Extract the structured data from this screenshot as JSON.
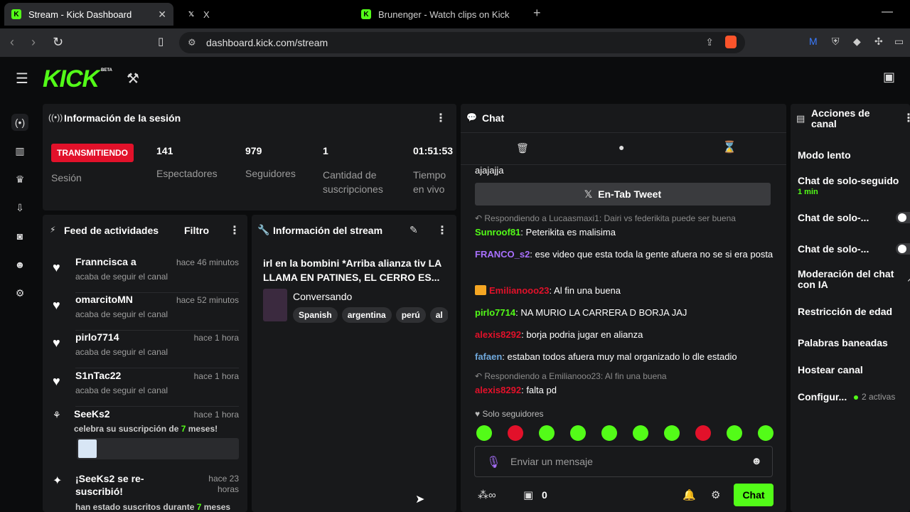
{
  "browser": {
    "tabs": [
      {
        "title": "Stream - Kick Dashboard",
        "icon": "kick-icon"
      },
      {
        "title": "X",
        "icon": "x-icon"
      },
      {
        "title": "Brunenger - Watch clips on Kick",
        "icon": "kick-icon"
      }
    ],
    "url": "dashboard.kick.com/stream"
  },
  "app": {
    "logo": "KICK",
    "badge": "BETA",
    "accent": "#53fc18"
  },
  "session": {
    "title": "Información de la sesión",
    "status": "TRANSMITIENDO",
    "status_label": "Sesión",
    "stats": [
      {
        "value": "141",
        "label": "Espectadores"
      },
      {
        "value": "979",
        "label": "Seguidores"
      },
      {
        "value": "1",
        "label": "Cantidad de suscripciones"
      },
      {
        "value": "01:51:53",
        "label": "Tiempo en vivo"
      }
    ]
  },
  "feed": {
    "title": "Feed de actividades",
    "filter": "Filtro",
    "items": [
      {
        "name": "Franncisca a",
        "time": "hace 46 minutos",
        "desc": "acaba de seguir el canal"
      },
      {
        "name": "omarcitoMN",
        "time": "hace 52 minutos",
        "desc": "acaba de seguir el canal"
      },
      {
        "name": "pirlo7714",
        "time": "hace 1 hora",
        "desc": "acaba de seguir el canal"
      },
      {
        "name": "S1nTac22",
        "time": "hace 1 hora",
        "desc": "acaba de seguir el canal"
      }
    ],
    "sub": {
      "name": "SeeKs2",
      "time": "hace 1 hora",
      "desc_pre": "celebra su suscripción de ",
      "months": "7",
      "desc_post": " meses!"
    },
    "resub": {
      "name": "¡SeeKs2 se re-suscribió!",
      "time": "hace 23 horas",
      "desc_pre": "han estado suscritos durante ",
      "months": "7",
      "desc_post": " meses"
    }
  },
  "stream": {
    "title": "Información del stream",
    "stream_title": "irl en la bombini *Arriba alianza tiv LA LLAMA EN PATINES, EL CERRO ES...",
    "category": "Conversando",
    "tags": [
      "Spanish",
      "argentina",
      "perú",
      "al"
    ]
  },
  "chat": {
    "title": "Chat",
    "top_text": "ajajajja",
    "pinned": "En-Tab Tweet",
    "reply1": "Respondiendo a Lucaasmaxi1: Dairi vs federikita puede ser buena",
    "messages": [
      {
        "user": "Sunroof81",
        "color": "#53fc18",
        "text": "Peterikita es malisima"
      },
      {
        "user": "FRANCO_s2",
        "color": "#a970ff",
        "text": "ese video que esta toda la gente afuera no se si era posta"
      },
      {
        "user": "Emilianooo23",
        "color": "#e2112a",
        "text": "Al fin una buena"
      },
      {
        "user": "pirlo7714",
        "color": "#53fc18",
        "text": "NA MURIO LA CARRERA D BORJA JAJ"
      },
      {
        "user": "alexis8292",
        "color": "#e2112a",
        "text": "borja podria jugar en alianza"
      },
      {
        "user": "fafaen",
        "color": "#6fa8dc",
        "text": "estaban todos afuera muy mal organizado lo dle estadio"
      }
    ],
    "reply2": "Respondiendo a Emilianooo23: Al fin una buena",
    "last": {
      "user": "alexis8292",
      "color": "#e2112a",
      "text": "falta pd"
    },
    "followers_only": "Solo seguidores",
    "placeholder": "Enviar un mensaje",
    "send": "Chat",
    "counter": "0"
  },
  "actions": {
    "title": "Acciones de canal",
    "slow": "Modo lento",
    "followers": "Chat de solo-seguido",
    "followers_time": "1 min",
    "sub_only": "Chat de solo-...",
    "emote_only": "Chat de solo-...",
    "ai_mod": "Moderación del chat con IA",
    "age": "Restricción de edad",
    "banned": "Palabras baneadas",
    "host": "Hostear canal",
    "config": "Configur...",
    "config_active": "2 activas"
  }
}
